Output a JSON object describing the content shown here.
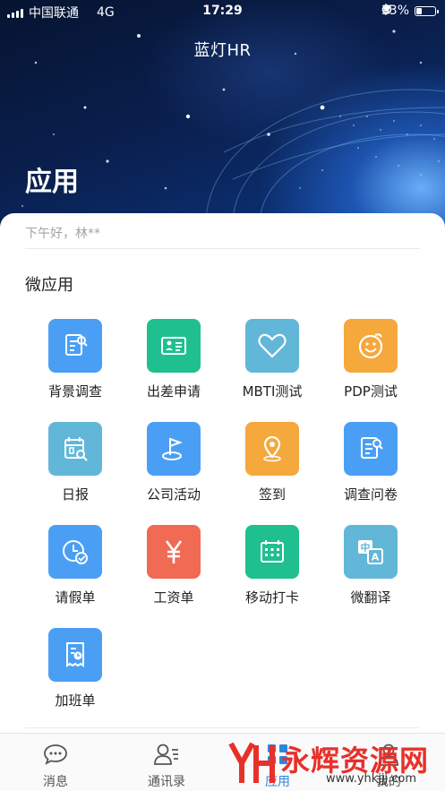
{
  "status_bar": {
    "carrier": "中国联通",
    "network": "4G",
    "time": "17:29",
    "battery": "33%",
    "battery_level": 0.33
  },
  "header": {
    "app_title": "蓝灯HR",
    "page_heading": "应用"
  },
  "greeting": "下午好，林**",
  "section_title": "微应用",
  "apps": [
    {
      "label": "背景调查",
      "icon": "document-search-icon",
      "color": "#4a9ff5"
    },
    {
      "label": "出差申请",
      "icon": "id-card-icon",
      "color": "#1fbf8f"
    },
    {
      "label": "MBTI测试",
      "icon": "heart-icon",
      "color": "#62b7d8"
    },
    {
      "label": "PDP测试",
      "icon": "smiley-icon",
      "color": "#f5a83c"
    },
    {
      "label": "日报",
      "icon": "calendar-search-icon",
      "color": "#62b7d8"
    },
    {
      "label": "公司活动",
      "icon": "flag-icon",
      "color": "#4a9ff5"
    },
    {
      "label": "签到",
      "icon": "location-pin-icon",
      "color": "#f5a83c"
    },
    {
      "label": "调查问卷",
      "icon": "questionnaire-icon",
      "color": "#4a9ff5"
    },
    {
      "label": "请假单",
      "icon": "clock-check-icon",
      "color": "#4a9ff5"
    },
    {
      "label": "工资单",
      "icon": "yen-icon",
      "color": "#f06a54"
    },
    {
      "label": "移动打卡",
      "icon": "calendar-grid-icon",
      "color": "#1fbf8f"
    },
    {
      "label": "微翻译",
      "icon": "translate-icon",
      "color": "#62b7d8"
    },
    {
      "label": "加班单",
      "icon": "receipt-clock-icon",
      "color": "#4a9ff5"
    }
  ],
  "tabs": [
    {
      "label": "消息",
      "icon": "chat-bubble-icon",
      "active": false
    },
    {
      "label": "通讯录",
      "icon": "contacts-icon",
      "active": false
    },
    {
      "label": "应用",
      "icon": "apps-icon",
      "active": true
    },
    {
      "label": "我的",
      "icon": "profile-icon",
      "active": false
    }
  ],
  "watermark": {
    "text": "永辉资源网",
    "url": "www.yhkjjj.com"
  }
}
